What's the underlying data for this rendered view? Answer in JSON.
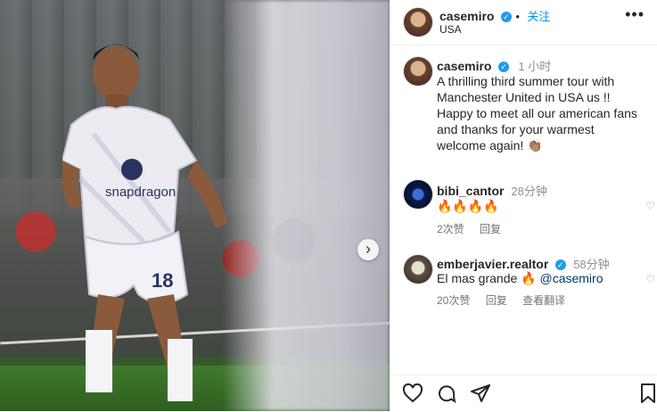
{
  "post_author": {
    "username": "casemiro",
    "follow_label": "关注",
    "location": "USA"
  },
  "caption": {
    "username": "casemiro",
    "time": "1 小时",
    "text": "A thrilling third summer tour with Manchester United in USA us !! Happy to meet all our american fans and thanks for your warmest welcome again!",
    "emoji": "👏🏽"
  },
  "comments": [
    {
      "username": "bibi_cantor",
      "time": "28分钟",
      "text": "🔥🔥🔥🔥",
      "likes": "2次赞",
      "reply": "回复",
      "translate": ""
    },
    {
      "username": "emberjavier.realtor",
      "time": "58分钟",
      "text": "El mas grande 🔥",
      "mention": "@casemiro",
      "likes": "20次赞",
      "reply": "回复",
      "translate": "查看翻译"
    }
  ],
  "media": {
    "jersey_sponsor": "snapdragon",
    "jersey_number": "18"
  },
  "icons": {
    "like": "heart-icon",
    "comment": "comment-icon",
    "share": "share-icon",
    "save": "bookmark-icon",
    "more": "more-icon",
    "next": "chevron-right-icon"
  },
  "colors": {
    "accent": "#0095f6",
    "verified": "#1d9bf0",
    "mention": "#00376b"
  }
}
